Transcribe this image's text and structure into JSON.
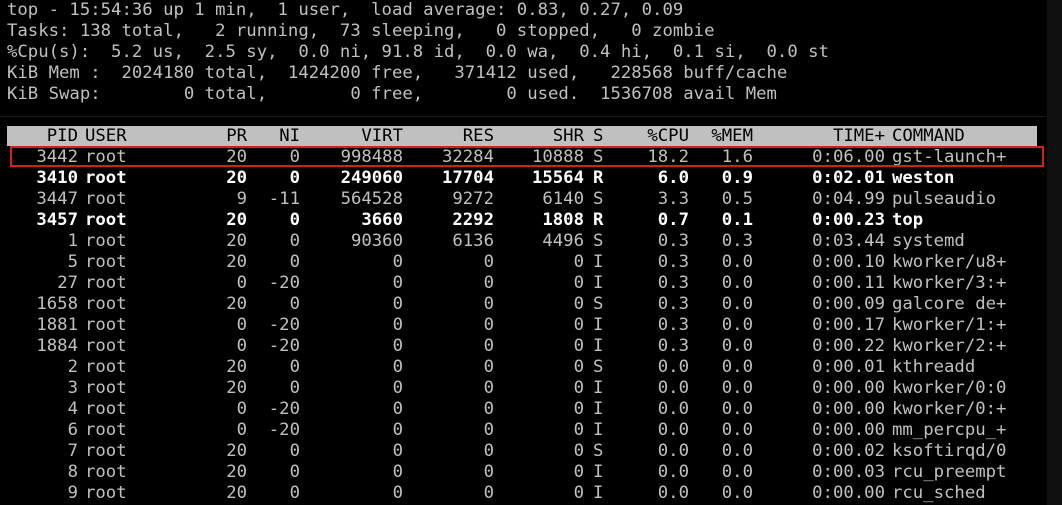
{
  "summary": {
    "line1": "top - 15:54:36 up 1 min,  1 user,  load average: 0.83, 0.27, 0.09",
    "line2": "Tasks: 138 total,   2 running,  73 sleeping,   0 stopped,   0 zombie",
    "line3": "%Cpu(s):  5.2 us,  2.5 sy,  0.0 ni, 91.8 id,  0.0 wa,  0.4 hi,  0.1 si,  0.0 st",
    "line4": "KiB Mem :  2024180 total,  1424200 free,   371412 used,   228568 buff/cache",
    "line5": "KiB Swap:        0 total,        0 free,        0 used.  1536708 avail Mem"
  },
  "table": {
    "headers": {
      "pid": "PID",
      "user": "USER",
      "pr": "PR",
      "ni": "NI",
      "virt": "VIRT",
      "res": "RES",
      "shr": "SHR",
      "s": "S",
      "cpu": "%CPU",
      "mem": "%MEM",
      "time": "TIME+",
      "cmd": "COMMAND"
    },
    "rows": [
      {
        "pid": "3442",
        "user": "root",
        "pr": "20",
        "ni": "0",
        "virt": "998488",
        "res": "32284",
        "shr": "10888",
        "s": "S",
        "cpu": "18.2",
        "mem": "1.6",
        "time": "0:06.00",
        "cmd": "gst-launch+",
        "bold": false,
        "highlighted": true
      },
      {
        "pid": "3410",
        "user": "root",
        "pr": "20",
        "ni": "0",
        "virt": "249060",
        "res": "17704",
        "shr": "15564",
        "s": "R",
        "cpu": "6.0",
        "mem": "0.9",
        "time": "0:02.01",
        "cmd": "weston",
        "bold": true
      },
      {
        "pid": "3447",
        "user": "root",
        "pr": "9",
        "ni": "-11",
        "virt": "564528",
        "res": "9272",
        "shr": "6140",
        "s": "S",
        "cpu": "3.3",
        "mem": "0.5",
        "time": "0:04.99",
        "cmd": "pulseaudio",
        "bold": false
      },
      {
        "pid": "3457",
        "user": "root",
        "pr": "20",
        "ni": "0",
        "virt": "3660",
        "res": "2292",
        "shr": "1808",
        "s": "R",
        "cpu": "0.7",
        "mem": "0.1",
        "time": "0:00.23",
        "cmd": "top",
        "bold": true
      },
      {
        "pid": "1",
        "user": "root",
        "pr": "20",
        "ni": "0",
        "virt": "90360",
        "res": "6136",
        "shr": "4496",
        "s": "S",
        "cpu": "0.3",
        "mem": "0.3",
        "time": "0:03.44",
        "cmd": "systemd",
        "bold": false
      },
      {
        "pid": "5",
        "user": "root",
        "pr": "20",
        "ni": "0",
        "virt": "0",
        "res": "0",
        "shr": "0",
        "s": "I",
        "cpu": "0.3",
        "mem": "0.0",
        "time": "0:00.10",
        "cmd": "kworker/u8+",
        "bold": false
      },
      {
        "pid": "27",
        "user": "root",
        "pr": "0",
        "ni": "-20",
        "virt": "0",
        "res": "0",
        "shr": "0",
        "s": "I",
        "cpu": "0.3",
        "mem": "0.0",
        "time": "0:00.11",
        "cmd": "kworker/3:+",
        "bold": false
      },
      {
        "pid": "1658",
        "user": "root",
        "pr": "20",
        "ni": "0",
        "virt": "0",
        "res": "0",
        "shr": "0",
        "s": "S",
        "cpu": "0.3",
        "mem": "0.0",
        "time": "0:00.09",
        "cmd": "galcore de+",
        "bold": false
      },
      {
        "pid": "1881",
        "user": "root",
        "pr": "0",
        "ni": "-20",
        "virt": "0",
        "res": "0",
        "shr": "0",
        "s": "I",
        "cpu": "0.3",
        "mem": "0.0",
        "time": "0:00.17",
        "cmd": "kworker/1:+",
        "bold": false
      },
      {
        "pid": "1884",
        "user": "root",
        "pr": "0",
        "ni": "-20",
        "virt": "0",
        "res": "0",
        "shr": "0",
        "s": "I",
        "cpu": "0.3",
        "mem": "0.0",
        "time": "0:00.22",
        "cmd": "kworker/2:+",
        "bold": false
      },
      {
        "pid": "2",
        "user": "root",
        "pr": "20",
        "ni": "0",
        "virt": "0",
        "res": "0",
        "shr": "0",
        "s": "S",
        "cpu": "0.0",
        "mem": "0.0",
        "time": "0:00.01",
        "cmd": "kthreadd",
        "bold": false
      },
      {
        "pid": "3",
        "user": "root",
        "pr": "20",
        "ni": "0",
        "virt": "0",
        "res": "0",
        "shr": "0",
        "s": "I",
        "cpu": "0.0",
        "mem": "0.0",
        "time": "0:00.00",
        "cmd": "kworker/0:0",
        "bold": false
      },
      {
        "pid": "4",
        "user": "root",
        "pr": "0",
        "ni": "-20",
        "virt": "0",
        "res": "0",
        "shr": "0",
        "s": "I",
        "cpu": "0.0",
        "mem": "0.0",
        "time": "0:00.00",
        "cmd": "kworker/0:+",
        "bold": false
      },
      {
        "pid": "6",
        "user": "root",
        "pr": "0",
        "ni": "-20",
        "virt": "0",
        "res": "0",
        "shr": "0",
        "s": "I",
        "cpu": "0.0",
        "mem": "0.0",
        "time": "0:00.00",
        "cmd": "mm_percpu_+",
        "bold": false
      },
      {
        "pid": "7",
        "user": "root",
        "pr": "20",
        "ni": "0",
        "virt": "0",
        "res": "0",
        "shr": "0",
        "s": "S",
        "cpu": "0.0",
        "mem": "0.0",
        "time": "0:00.02",
        "cmd": "ksoftirqd/0",
        "bold": false
      },
      {
        "pid": "8",
        "user": "root",
        "pr": "20",
        "ni": "0",
        "virt": "0",
        "res": "0",
        "shr": "0",
        "s": "I",
        "cpu": "0.0",
        "mem": "0.0",
        "time": "0:00.03",
        "cmd": "rcu_preempt",
        "bold": false
      },
      {
        "pid": "9",
        "user": "root",
        "pr": "20",
        "ni": "0",
        "virt": "0",
        "res": "0",
        "shr": "0",
        "s": "I",
        "cpu": "0.0",
        "mem": "0.0",
        "time": "0:00.00",
        "cmd": "rcu_sched",
        "bold": false
      }
    ]
  },
  "colors": {
    "background": "#000000",
    "text": "#c0c0c0",
    "bold_text": "#ffffff",
    "header_bar": "#c0c0c0",
    "highlight_border": "#d02020"
  }
}
